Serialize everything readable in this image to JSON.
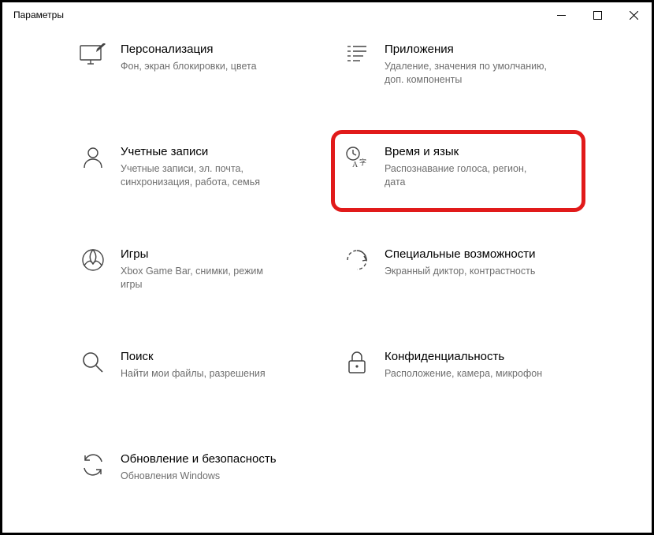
{
  "window": {
    "title": "Параметры"
  },
  "tiles": [
    {
      "key": "personalization",
      "title": "Персонализация",
      "desc": "Фон, экран блокировки, цвета",
      "highlighted": false
    },
    {
      "key": "apps",
      "title": "Приложения",
      "desc": "Удаление, значения по умолчанию, доп. компоненты",
      "highlighted": false
    },
    {
      "key": "accounts",
      "title": "Учетные записи",
      "desc": "Учетные записи, эл. почта, синхронизация, работа, семья",
      "highlighted": false
    },
    {
      "key": "time-language",
      "title": "Время и язык",
      "desc": "Распознавание голоса, регион, дата",
      "highlighted": true
    },
    {
      "key": "gaming",
      "title": "Игры",
      "desc": "Xbox Game Bar, снимки, режим игры",
      "highlighted": false
    },
    {
      "key": "ease-of-access",
      "title": "Специальные возможности",
      "desc": "Экранный диктор, контрастность",
      "highlighted": false
    },
    {
      "key": "search",
      "title": "Поиск",
      "desc": "Найти мои файлы, разрешения",
      "highlighted": false
    },
    {
      "key": "privacy",
      "title": "Конфиденциальность",
      "desc": "Расположение, камера, микрофон",
      "highlighted": false
    },
    {
      "key": "update-security",
      "title": "Обновление и безопасность",
      "desc": "Обновления Windows",
      "highlighted": false
    }
  ]
}
